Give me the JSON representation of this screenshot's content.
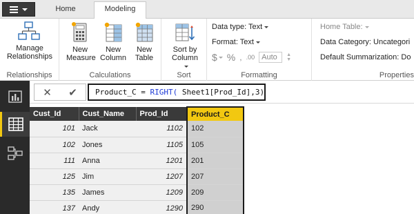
{
  "tabs": {
    "home": "Home",
    "modeling": "Modeling"
  },
  "ribbon": {
    "relationships": {
      "button": "Manage Relationships",
      "group": "Relationships"
    },
    "calculations": {
      "new_measure": "New Measure",
      "new_column": "New Column",
      "new_table": "New Table",
      "group": "Calculations"
    },
    "sort": {
      "button": "Sort by Column",
      "group": "Sort"
    },
    "formatting": {
      "data_type": "Data type: Text",
      "format": "Format: Text",
      "dollar": "$",
      "percent": "%",
      "comma": ",",
      "decimals": ".00",
      "auto": "Auto",
      "group": "Formatting"
    },
    "properties": {
      "home_table": "Home Table:",
      "data_category": "Data Category: Uncategori",
      "default_summarization": "Default Summarization: Do",
      "group": "Properties"
    }
  },
  "formula": {
    "cancel": "✕",
    "commit": "✔",
    "prefix": "Product_C = ",
    "function": "RIGHT(",
    "args": " Sheet1[Prod_Id],3)"
  },
  "grid": {
    "columns": [
      "Cust_Id",
      "Cust_Name",
      "Prod_Id",
      "Product_C"
    ],
    "rows": [
      {
        "cust_id": "101",
        "cust_name": "Jack",
        "prod_id": "1102",
        "product_c": "102"
      },
      {
        "cust_id": "102",
        "cust_name": "Jones",
        "prod_id": "1105",
        "product_c": "105"
      },
      {
        "cust_id": "111",
        "cust_name": "Anna",
        "prod_id": "1201",
        "product_c": "201"
      },
      {
        "cust_id": "125",
        "cust_name": "Jim",
        "prod_id": "1207",
        "product_c": "207"
      },
      {
        "cust_id": "135",
        "cust_name": "James",
        "prod_id": "1209",
        "product_c": "209"
      },
      {
        "cust_id": "137",
        "cust_name": "Andy",
        "prod_id": "1290",
        "product_c": "290"
      }
    ]
  },
  "colors": {
    "accent": "#f2c811",
    "nav_bg": "#2a2a2a",
    "header_bg": "#3a3a3a",
    "function_blue": "#1e3ad6"
  }
}
